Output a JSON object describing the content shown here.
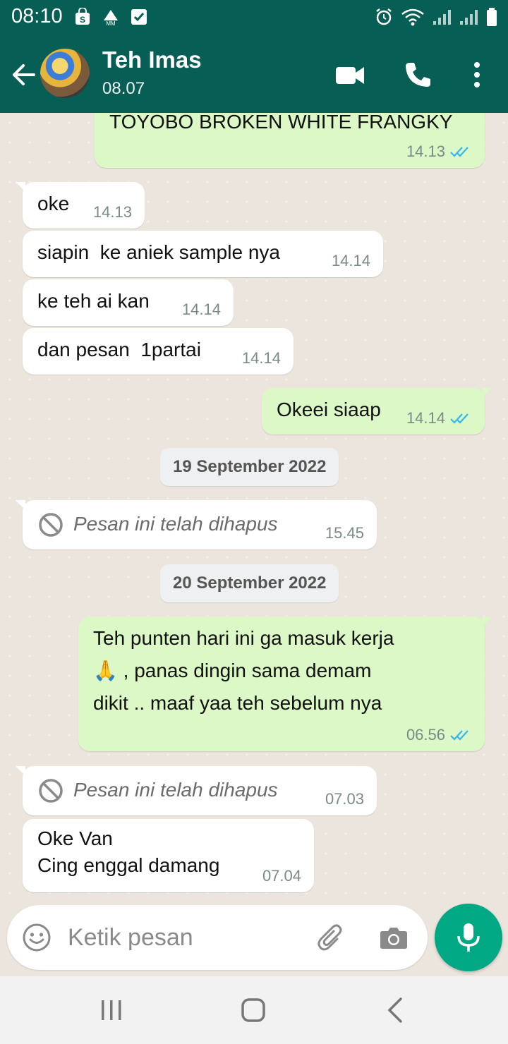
{
  "status_bar": {
    "time": "08:10",
    "colors": {
      "bar": "#075e54"
    }
  },
  "header": {
    "contact_name": "Teh Imas",
    "contact_status": "08.07",
    "icons": [
      "back-arrow-icon",
      "video-call-icon",
      "phone-icon",
      "more-vertical-icon"
    ]
  },
  "messages": [
    {
      "dir": "out",
      "text": "TOYOBO BROKEN WHITE FRANGKY",
      "time": "14.13",
      "read": true
    },
    {
      "dir": "in",
      "text": "oke",
      "time": "14.13"
    },
    {
      "dir": "in",
      "text": "siapin  ke aniek sample nya",
      "time": "14.14"
    },
    {
      "dir": "in",
      "text": "ke teh ai kan",
      "time": "14.14"
    },
    {
      "dir": "in",
      "text": "dan pesan  1partai",
      "time": "14.14"
    },
    {
      "dir": "out",
      "text": "Okeei siaap",
      "time": "14.14",
      "read": true
    },
    {
      "date": "19 September 2022"
    },
    {
      "dir": "in",
      "deleted": true,
      "text": "Pesan ini telah dihapus",
      "time": "15.45"
    },
    {
      "date": "20 September 2022"
    },
    {
      "dir": "out",
      "lines": [
        "Teh punten hari ini ga masuk kerja",
        "🙏 , panas dingin sama demam",
        "dikit .. maaf yaa teh sebelum nya"
      ],
      "time": "06.56",
      "read": true
    },
    {
      "dir": "in",
      "deleted": true,
      "text": "Pesan ini telah dihapus",
      "time": "07.03"
    },
    {
      "dir": "in",
      "lines": [
        "Oke Van",
        "Cing enggal damang"
      ],
      "time": "07.04"
    }
  ],
  "composer": {
    "placeholder": "Ketik pesan",
    "icons": [
      "emoji-icon",
      "attachment-icon",
      "camera-icon",
      "mic-icon"
    ]
  },
  "colors": {
    "header": "#075e54",
    "outgoing_bubble": "#dcf8c6",
    "incoming_bubble": "#ffffff",
    "read_tick": "#34b7f1",
    "mic_button": "#00a884"
  }
}
